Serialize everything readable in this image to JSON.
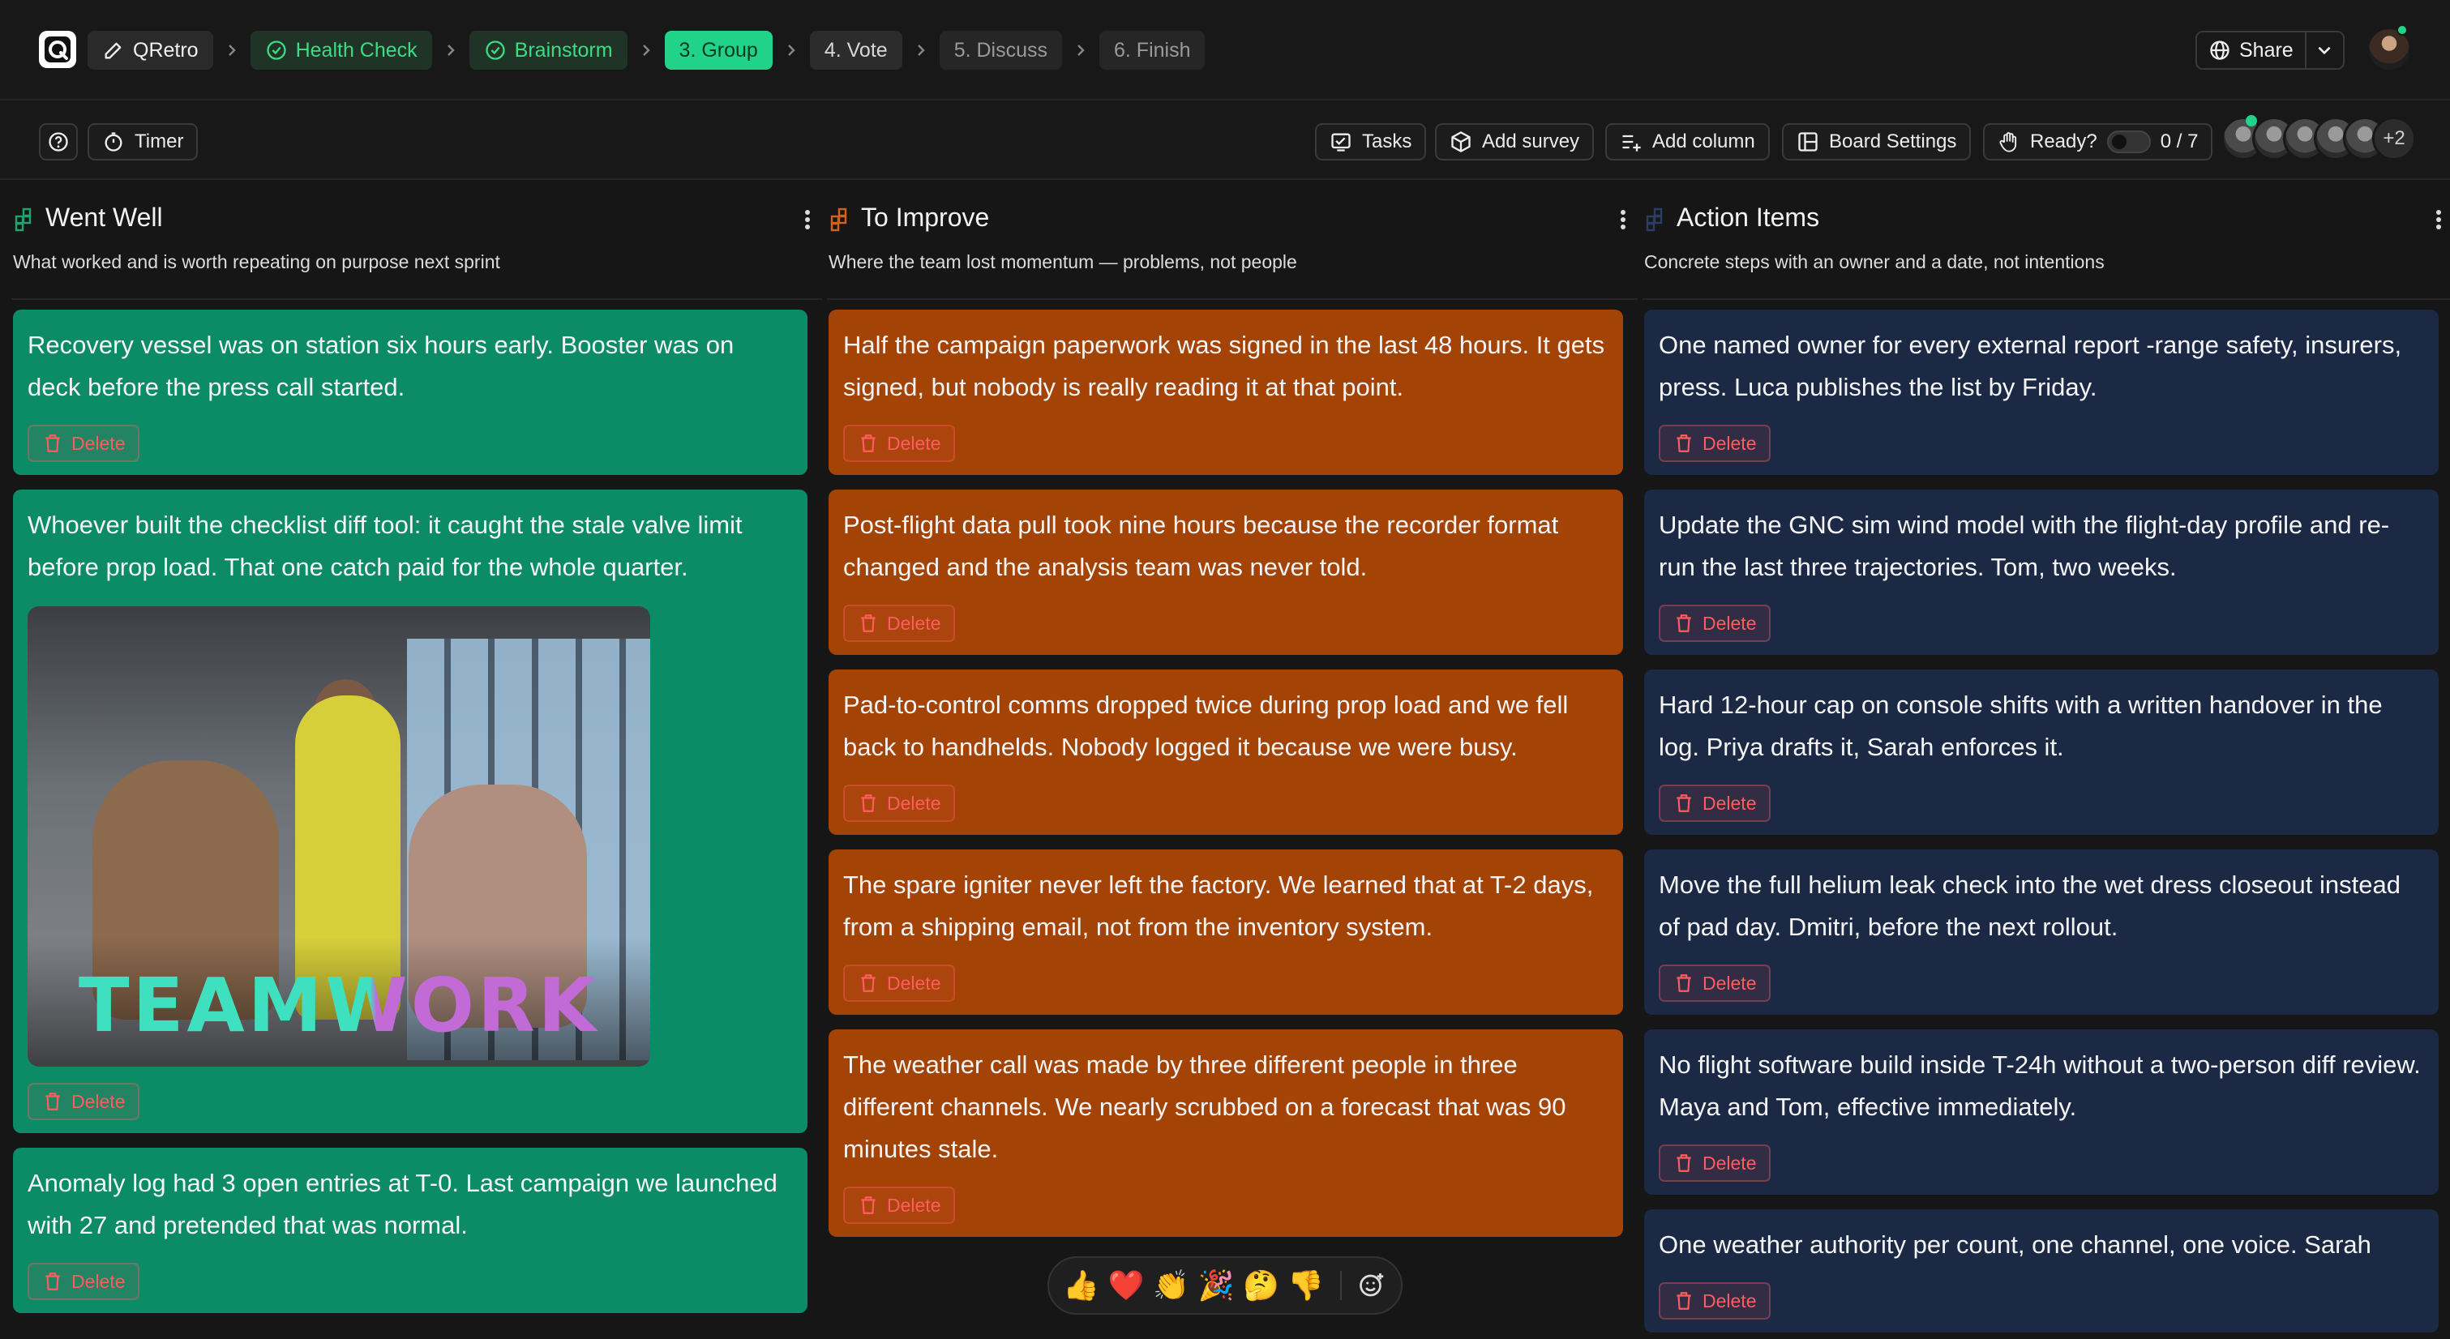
{
  "header": {
    "app_name": "QRetro",
    "steps": [
      {
        "label": "Health Check"
      },
      {
        "label": "Brainstorm"
      },
      {
        "label": "3. Group"
      },
      {
        "label": "4. Vote"
      },
      {
        "label": "5. Discuss"
      },
      {
        "label": "6. Finish"
      }
    ],
    "share_label": "Share"
  },
  "toolbar": {
    "timer_label": "Timer",
    "tasks_label": "Tasks",
    "add_survey_label": "Add survey",
    "add_column_label": "Add column",
    "board_settings_label": "Board Settings",
    "ready_label": "Ready?",
    "ready_count": "0 / 7",
    "extra_participants": "+2"
  },
  "columns": [
    {
      "title": "Went Well",
      "description": "What worked and is worth repeating on purpose next sprint",
      "icon_color": "#1fa36f",
      "cards": [
        {
          "text": "Recovery vessel was on station six hours early. Booster was on deck before the press call started.",
          "delete_label": "Delete"
        },
        {
          "text": "Whoever built the checklist diff tool: it caught the stale valve limit before prop load. That one catch paid for the whole quarter.",
          "gif_caption": "TEAMWORK",
          "delete_label": "Delete"
        },
        {
          "text": "Anomaly log had 3 open entries at T-0. Last campaign we launched with 27 and pretended that was normal.",
          "delete_label": "Delete"
        }
      ]
    },
    {
      "title": "To Improve",
      "description": "Where the team lost momentum — problems, not people",
      "icon_color": "#d4611a",
      "cards": [
        {
          "text": "Half the campaign paperwork was signed in the last 48 hours. It gets signed, but nobody is really reading it at that point.",
          "delete_label": "Delete"
        },
        {
          "text": "Post-flight data pull took nine hours because the recorder format changed and the analysis team was never told.",
          "delete_label": "Delete"
        },
        {
          "text": "Pad-to-control comms dropped twice during prop load and we fell back to handhelds. Nobody logged it because we were busy.",
          "delete_label": "Delete"
        },
        {
          "text": "The spare igniter never left the factory. We learned that at T-2 days, from a shipping email, not from the inventory system.",
          "delete_label": "Delete"
        },
        {
          "text": "The weather call was made by three different people in three different channels. We nearly scrubbed on a forecast that was 90 minutes stale.",
          "delete_label": "Delete"
        }
      ]
    },
    {
      "title": "Action Items",
      "description": "Concrete steps with an owner and a date, not intentions",
      "icon_color": "#2b3d63",
      "cards": [
        {
          "text": "One named owner for every external report -range safety, insurers, press. Luca publishes the list by Friday.",
          "delete_label": "Delete"
        },
        {
          "text": "Update the GNC sim wind model with the flight-day profile and re-run the last three trajectories. Tom, two weeks.",
          "delete_label": "Delete"
        },
        {
          "text": "Hard 12-hour cap on console shifts with a written handover in the log. Priya drafts it, Sarah enforces it.",
          "delete_label": "Delete"
        },
        {
          "text": "Move the full helium leak check into the wet dress closeout instead of pad day. Dmitri, before the next rollout.",
          "delete_label": "Delete"
        },
        {
          "text": "No flight software build inside T-24h without a two-person diff review. Maya and Tom, effective immediately.",
          "delete_label": "Delete"
        },
        {
          "text": "One weather authority per count, one channel, one voice. Sarah",
          "delete_label": "Delete"
        }
      ]
    }
  ],
  "reactions": [
    "👍",
    "❤️",
    "👏",
    "🎉",
    "🤔",
    "👎"
  ],
  "colors": {
    "accent": "#20d389",
    "went_well_card": "#0b8b66",
    "to_improve_card": "#a34306",
    "action_items_card": "#1b2944",
    "delete": "#ff5d5d"
  }
}
